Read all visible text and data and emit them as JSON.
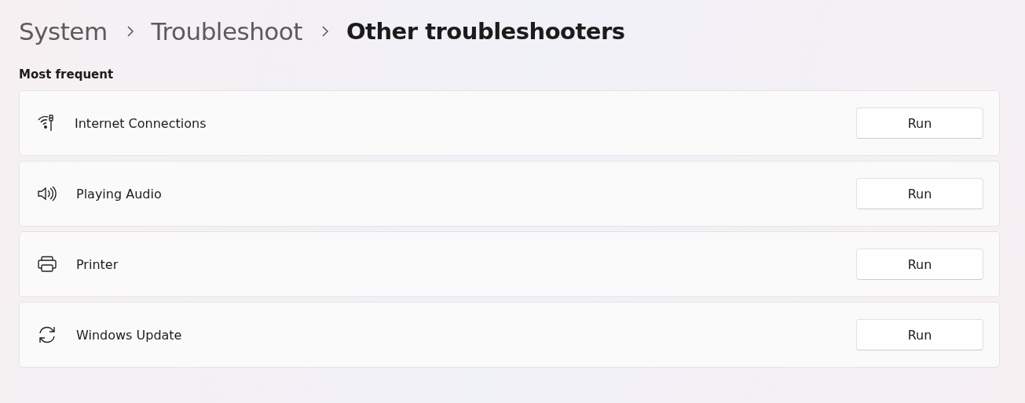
{
  "breadcrumb": [
    {
      "label": "System",
      "current": false
    },
    {
      "label": "Troubleshoot",
      "current": false
    },
    {
      "label": "Other troubleshooters",
      "current": true
    }
  ],
  "section_title": "Most frequent",
  "items": [
    {
      "kind": "wifi",
      "label": "Internet Connections",
      "button": "Run"
    },
    {
      "kind": "audio",
      "label": "Playing Audio",
      "button": "Run"
    },
    {
      "kind": "printer",
      "label": "Printer",
      "button": "Run"
    },
    {
      "kind": "update",
      "label": "Windows Update",
      "button": "Run"
    }
  ]
}
